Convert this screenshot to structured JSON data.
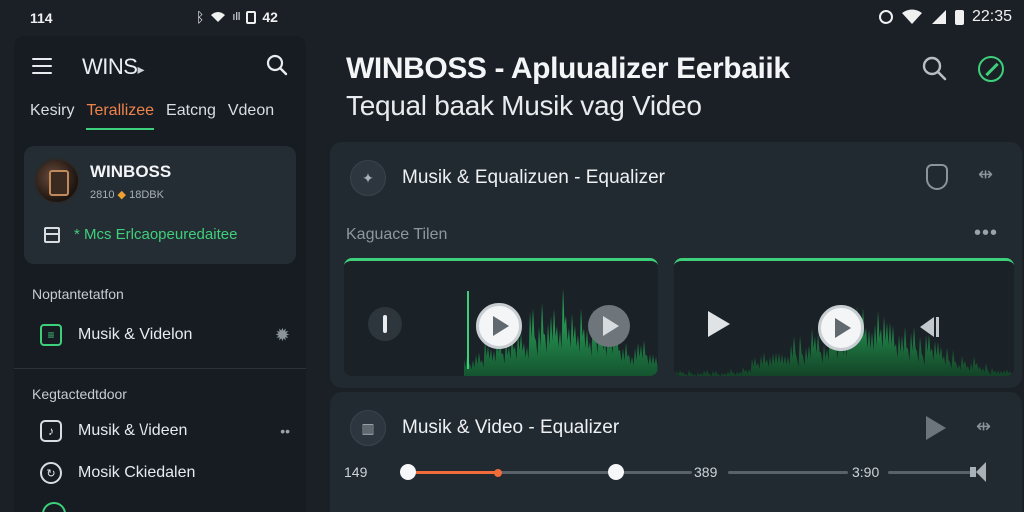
{
  "status_bar": {
    "left_time": "114",
    "left_extra": "42",
    "right_time": "22:35"
  },
  "sidebar": {
    "logo": "WINS",
    "tabs": [
      {
        "label": "Kesiry",
        "active": false
      },
      {
        "label": "Terallizee",
        "active": true
      },
      {
        "label": "Eatcng",
        "active": false
      },
      {
        "label": "Vdeon",
        "active": false
      }
    ],
    "profile": {
      "name": "WINBOSS",
      "meta_left": "2810",
      "meta_right": "18DBK",
      "link": "* Mcs Erlcaopeuredaitee"
    },
    "section1": {
      "heading": "Noptantetatfon",
      "items": [
        {
          "label": "Musik & Videlon",
          "icon": "equalizer-box-icon"
        }
      ]
    },
    "section2": {
      "heading": "Kegtactedtdoor",
      "items": [
        {
          "label": "Musik & \\/ideen",
          "icon": "music-note-icon",
          "right": "••"
        },
        {
          "label": "Mosik Ckiedalen",
          "icon": "cycle-icon"
        }
      ]
    }
  },
  "main": {
    "title": "WINBOSS - Apluualizer Eerbaiik",
    "subtitle": "Tequal baak Musik vag Video",
    "card1": {
      "title": "Musik & Equalizuen - Equalizer",
      "sub_label": "Kaguace Tilen",
      "more": "•••"
    },
    "card2": {
      "title": "Musik & Video - Equalizer",
      "slider": {
        "start_label": "149",
        "mid_label": "389",
        "end_label": "3:90",
        "progress": 0.33
      }
    }
  },
  "colors": {
    "accent_green": "#3ecf7a",
    "accent_orange": "#f06a3a",
    "background": "#1a2026",
    "card": "#222a31"
  }
}
